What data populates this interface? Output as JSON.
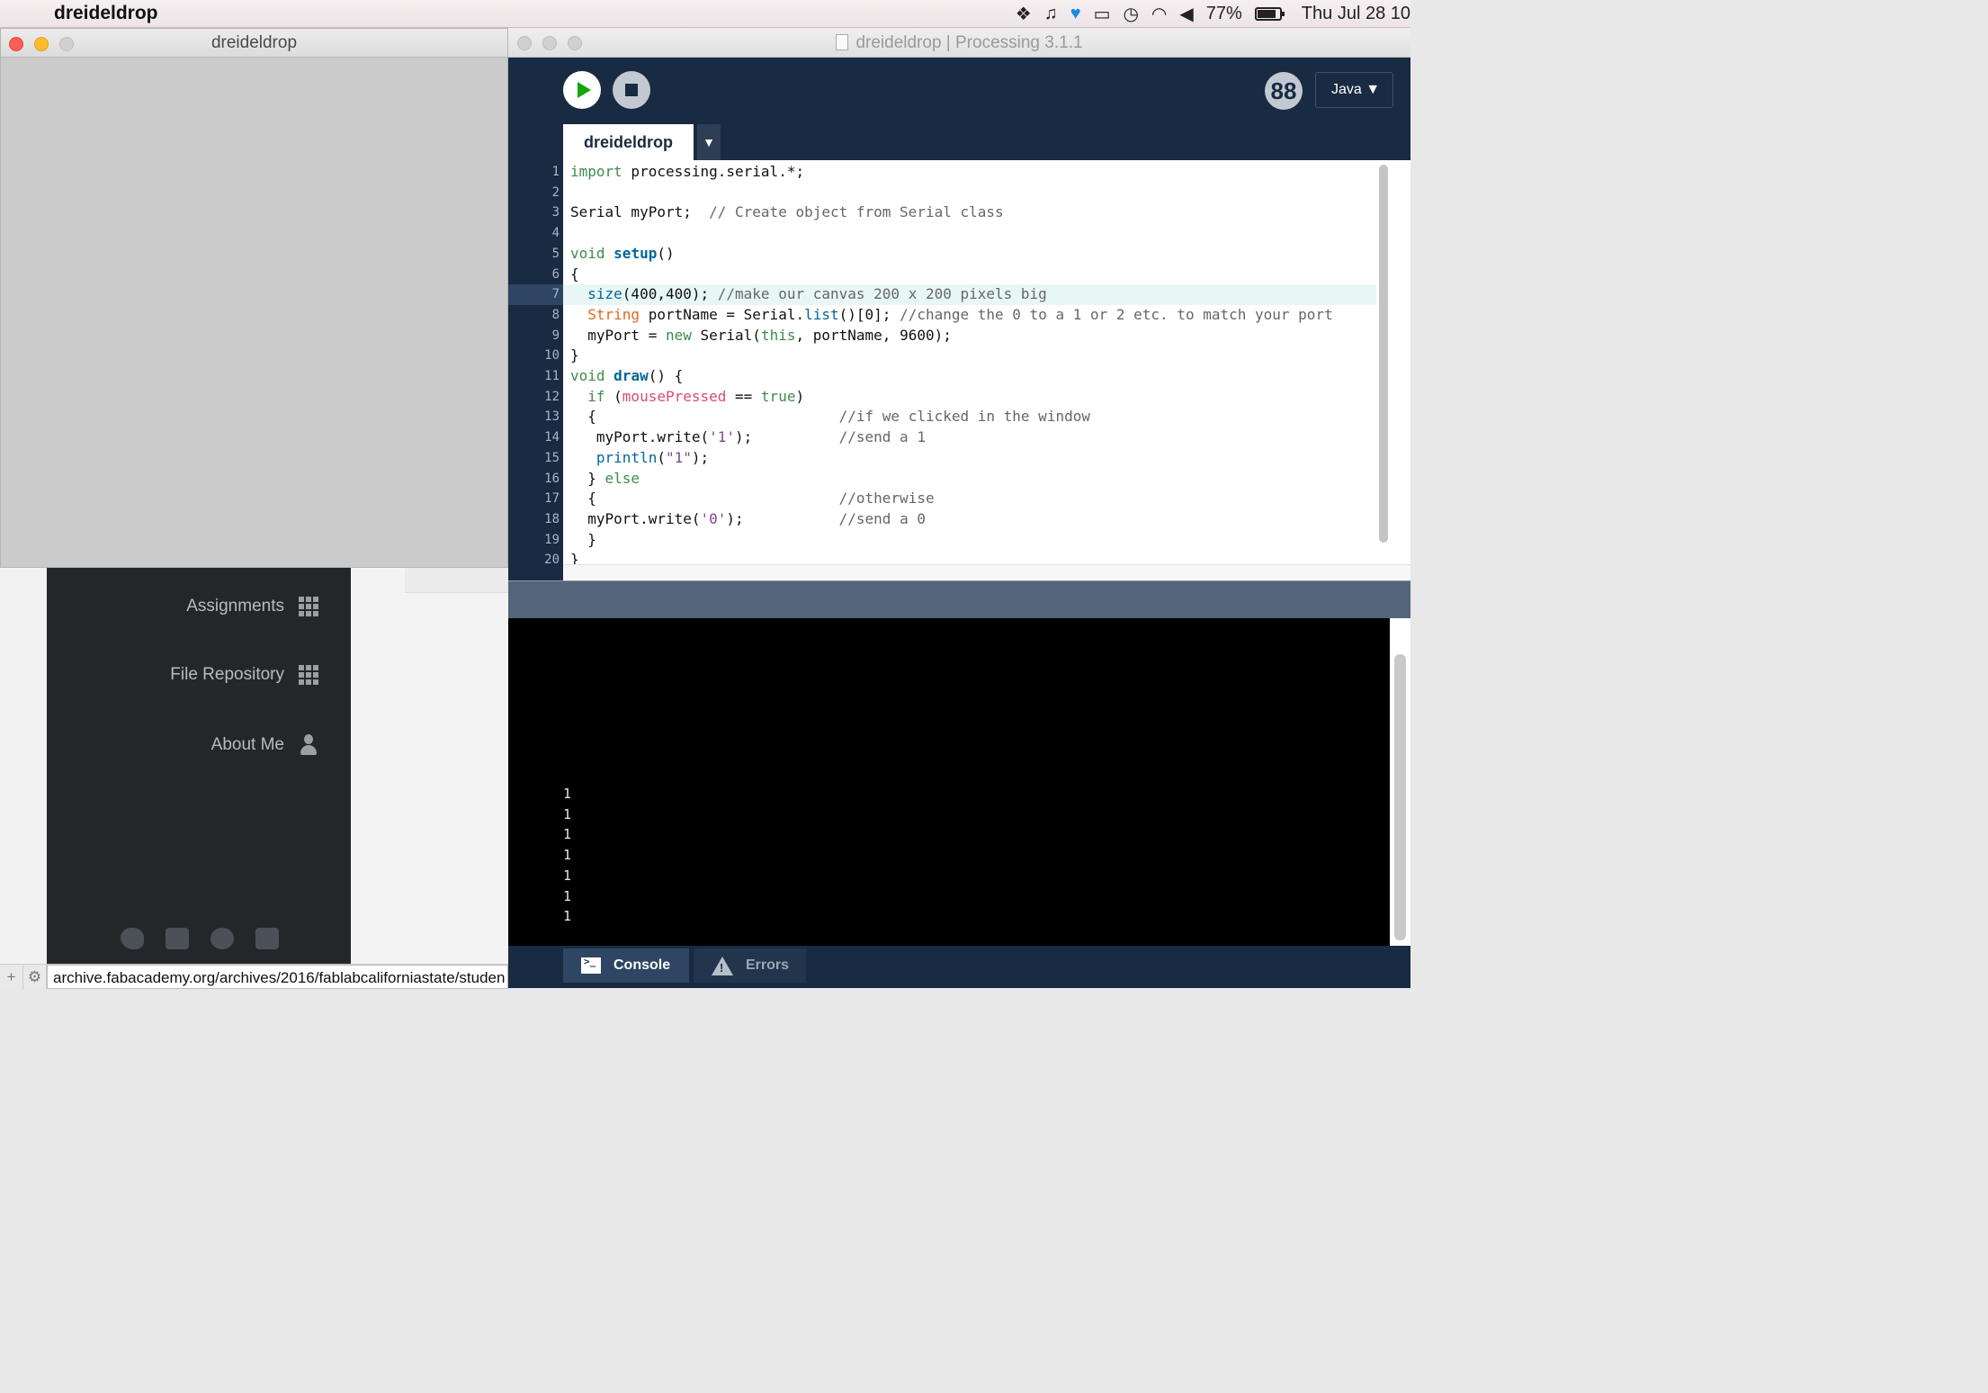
{
  "menubar": {
    "app_name": "dreideldrop",
    "battery": "77%",
    "clock": "Thu Jul 28  10"
  },
  "browser": {
    "nav": [
      {
        "label": "Assignments",
        "icon": "grid-icon"
      },
      {
        "label": "File Repository",
        "icon": "grid-icon"
      },
      {
        "label": "About Me",
        "icon": "person-icon"
      }
    ],
    "status_url": "archive.fabacademy.org/archives/2016/fablabcaliforniastate/studen"
  },
  "sketch_window": {
    "title": "dreideldrop"
  },
  "ide": {
    "title": "dreideldrop | Processing 3.1.1",
    "mode": "Java ▼",
    "mode_icon": "88",
    "tab": "dreideldrop",
    "tab_arrow": "▼",
    "line_numbers": [
      "1",
      "2",
      "3",
      "4",
      "5",
      "6",
      "7",
      "8",
      "9",
      "10",
      "11",
      "12",
      "13",
      "14",
      "15",
      "16",
      "17",
      "18",
      "19",
      "20"
    ],
    "console_output": [
      "1",
      "1",
      "1",
      "1",
      "1",
      "1",
      "1"
    ],
    "console_tab": "Console",
    "errors_tab": "Errors"
  },
  "code": {
    "l1a": "import",
    "l1b": " processing.serial.*;",
    "l3a": "Serial myPort;  ",
    "l3b": "// Create object from Serial class",
    "l5a": "void",
    "l5b": " ",
    "l5c": "setup",
    "l5d": "()",
    "l6": "{",
    "l7a": "  ",
    "l7b": "size",
    "l7c": "(400,400); ",
    "l7d": "//make our canvas 200 x 200 pixels big",
    "l8a": "  ",
    "l8b": "String",
    "l8c": " portName = Serial.",
    "l8d": "list",
    "l8e": "()[0]; ",
    "l8f": "//change the 0 to a 1 or 2 etc. to match your port",
    "l9a": "  myPort = ",
    "l9b": "new",
    "l9c": " Serial(",
    "l9d": "this",
    "l9e": ", portName, 9600);",
    "l10": "}",
    "l11a": "void",
    "l11b": " ",
    "l11c": "draw",
    "l11d": "() {",
    "l12a": "  ",
    "l12b": "if",
    "l12c": " (",
    "l12d": "mousePressed",
    "l12e": " == ",
    "l12f": "true",
    "l12g": ")",
    "l13a": "  {                            ",
    "l13b": "//if we clicked in the window",
    "l14a": "   myPort.write(",
    "l14b": "'1'",
    "l14c": ");          ",
    "l14d": "//send a 1",
    "l15a": "   ",
    "l15b": "println",
    "l15c": "(",
    "l15d": "\"1\"",
    "l15e": ");",
    "l16a": "  } ",
    "l16b": "else",
    "l17a": "  {                            ",
    "l17b": "//otherwise",
    "l18a": "  myPort.write(",
    "l18b": "'0'",
    "l18c": ");           ",
    "l18d": "//send a 0",
    "l19": "  }",
    "l20": "}"
  }
}
